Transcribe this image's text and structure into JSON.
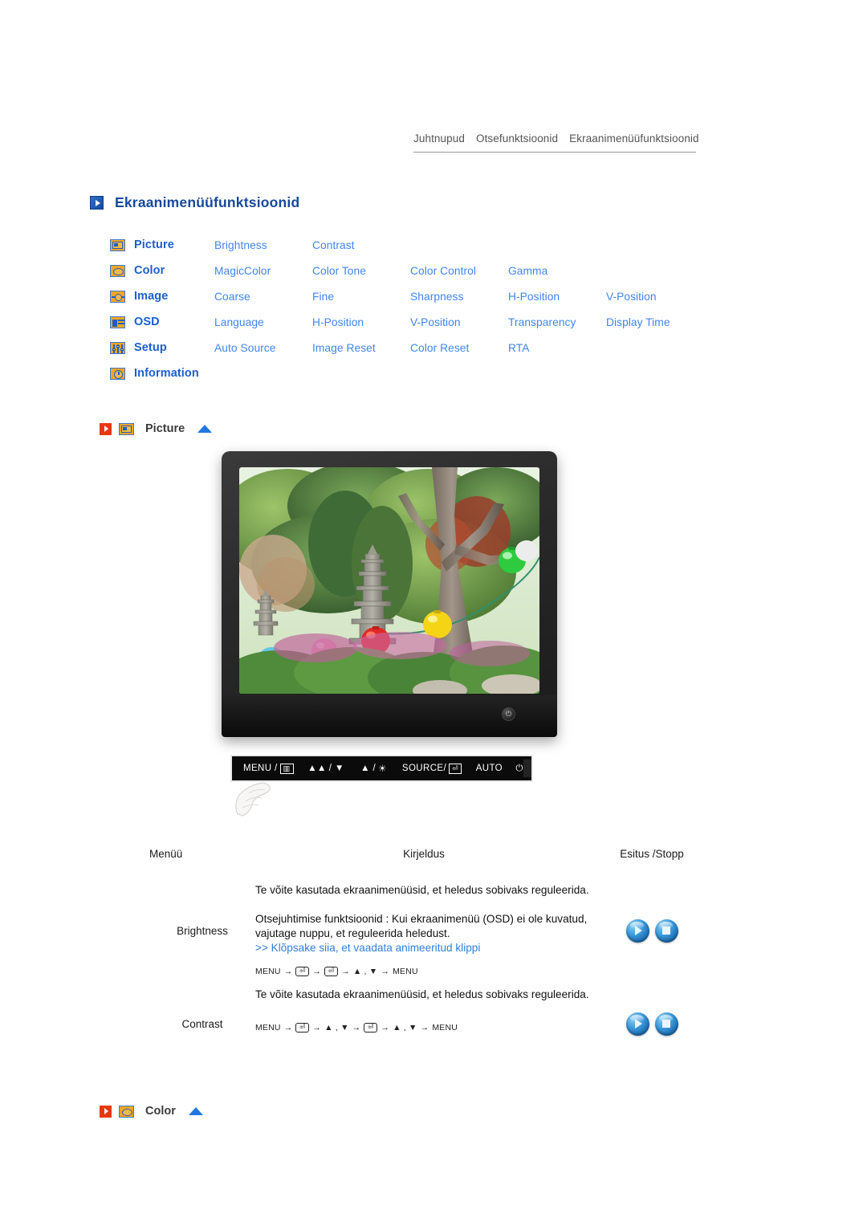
{
  "topnav": {
    "items": [
      "Juhtnupud",
      "Otsefunktsioonid",
      "Ekraanimenüüfunktsioonid"
    ]
  },
  "page": {
    "title": "Ekraanimenüüfunktsioonid"
  },
  "menu_map": [
    {
      "icon": "picture-icon",
      "category": "Picture",
      "links": [
        "Brightness",
        "Contrast"
      ]
    },
    {
      "icon": "color-icon",
      "category": "Color",
      "links": [
        "MagicColor",
        "Color Tone",
        "Color Control",
        "Gamma"
      ]
    },
    {
      "icon": "image-icon",
      "category": "Image",
      "links": [
        "Coarse",
        "Fine",
        "Sharpness",
        "H-Position",
        "V-Position"
      ]
    },
    {
      "icon": "osd-icon",
      "category": "OSD",
      "links": [
        "Language",
        "H-Position",
        "V-Position",
        "Transparency",
        "Display Time"
      ]
    },
    {
      "icon": "setup-icon",
      "category": "Setup",
      "links": [
        "Auto Source",
        "Image Reset",
        "Color Reset",
        "RTA"
      ]
    },
    {
      "icon": "information-icon",
      "category": "Information",
      "links": []
    }
  ],
  "sections": {
    "picture": {
      "label": "Picture"
    },
    "color": {
      "label": "Color"
    }
  },
  "control_bar": {
    "menu": "MENU /",
    "down": "/ ▼",
    "up": "▲ /",
    "source": "SOURCE/",
    "auto": "AUTO"
  },
  "table": {
    "headers": {
      "menu": "Menüü",
      "description": "Kirjeldus",
      "play": "Esitus /Stopp"
    },
    "rows": [
      {
        "menu": "Brightness",
        "lines": [
          "Te võite kasutada ekraanimenüüsid, et heledus sobivaks reguleerida.",
          "Otsejuhtimise funktsioonid : Kui ekraanimenüü (OSD) ei ole kuvatud, vajutage nuppu, et reguleerida heledust."
        ],
        "link": ">> Klõpsake siia, et vaadata animeeritud klippi",
        "keyseq": [
          "MENU",
          "→",
          "⏎",
          "→",
          "⏎",
          "→",
          "▲ , ▼",
          "→",
          "MENU"
        ]
      },
      {
        "menu": "Contrast",
        "lines": [
          "Te võite kasutada ekraanimenüüsid, et heledus sobivaks reguleerida."
        ],
        "link": "",
        "keyseq": [
          "MENU",
          "→",
          "⏎",
          "→",
          "▲ , ▼",
          "→",
          "⏎",
          "→",
          "▲ , ▼",
          "→",
          "MENU"
        ]
      }
    ]
  },
  "colors": {
    "title_blue": "#16499b",
    "link_blue": "#3f86f0",
    "category_blue": "#1a5fd0",
    "section_red": "#e8380d",
    "arrow_blue": "#2179e0"
  }
}
